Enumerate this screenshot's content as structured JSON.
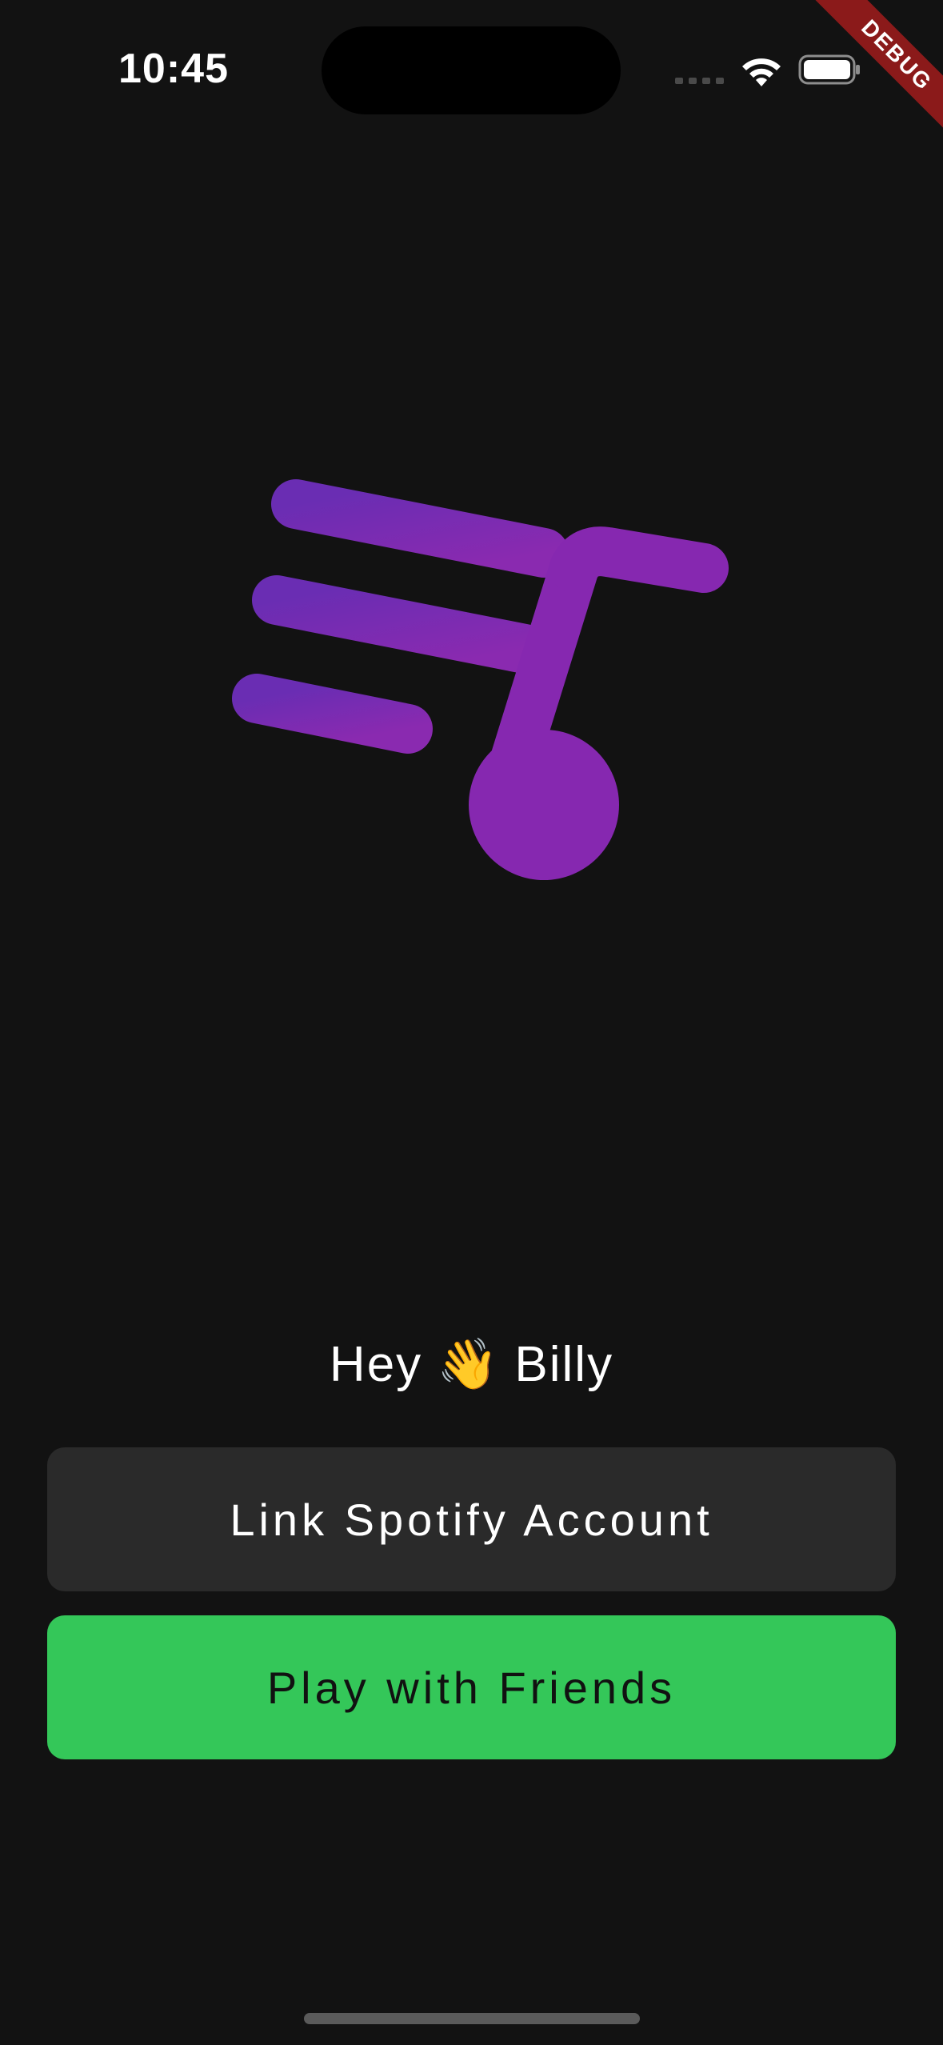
{
  "status_bar": {
    "time": "10:45",
    "icons": [
      "cellular-signal-icon",
      "wifi-icon",
      "battery-icon"
    ]
  },
  "debug_banner": {
    "label": "DEBUG",
    "color": "#8b1a1a"
  },
  "logo": {
    "icon": "music-note-logo",
    "colors": [
      "#6a2db3",
      "#8a2ab0"
    ]
  },
  "greeting": {
    "prefix": "Hey",
    "emoji": "👋",
    "name": "Billy"
  },
  "buttons": {
    "link_spotify": "Link Spotify Account",
    "play_with_friends": "Play with Friends"
  },
  "theme": {
    "background": "#121212",
    "secondary_button": "#2a2a2a",
    "accent": "#34c759"
  }
}
